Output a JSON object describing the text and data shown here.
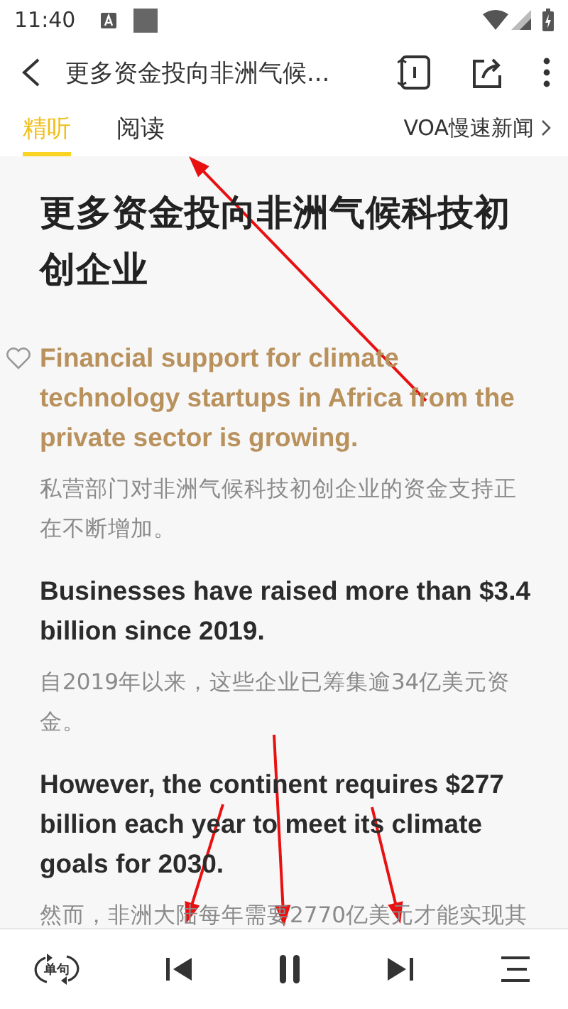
{
  "status_bar": {
    "time": "11:40"
  },
  "header": {
    "title": "更多资金投向非洲气候..."
  },
  "tabs": [
    {
      "label": "精听",
      "selected": true
    },
    {
      "label": "阅读",
      "selected": false
    }
  ],
  "source_link": {
    "label": "VOA慢速新闻"
  },
  "article": {
    "title": "更多资金投向非洲气候科技初创企业",
    "sentences": [
      {
        "english": "Financial support for climate technology startups in Africa from the private sector is growing.",
        "chinese": "私营部门对非洲气候科技初创企业的资金支持正在不断增加。",
        "current": true
      },
      {
        "english": "Businesses have raised more than $3.4 billion since 2019.",
        "chinese": "自2019年以来，这些企业已筹集逾34亿美元资金。",
        "current": false
      },
      {
        "english": "However, the continent requires $277 billion each year to meet its climate goals for 2030.",
        "chinese": "然而，非洲大陆每年需要2770亿美元才能实现其",
        "current": false
      }
    ]
  },
  "player": {
    "mode_label": "单句",
    "playing": true
  }
}
